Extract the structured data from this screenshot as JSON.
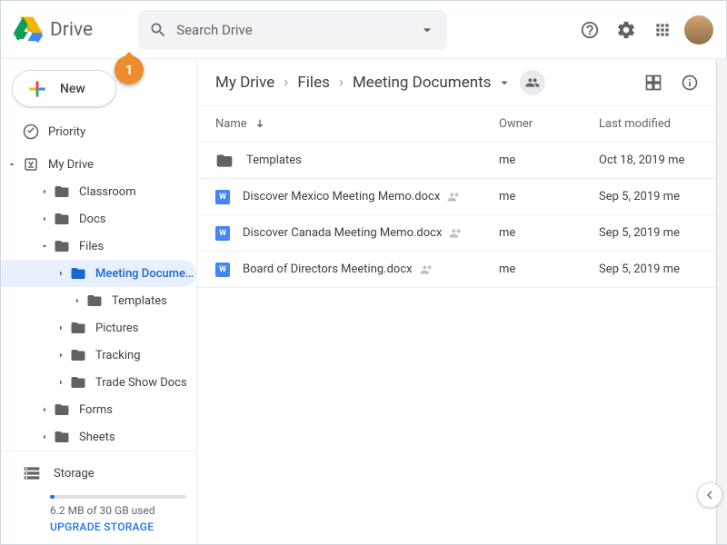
{
  "app": {
    "name": "Drive",
    "search_placeholder": "Search Drive",
    "new_label": "New"
  },
  "nav": {
    "priority": "Priority",
    "mydrive": "My Drive",
    "items": [
      {
        "label": "Classroom"
      },
      {
        "label": "Docs"
      },
      {
        "label": "Files",
        "expanded": true,
        "children": [
          {
            "label": "Meeting Documen...",
            "selected": true,
            "children": [
              {
                "label": "Templates"
              }
            ]
          },
          {
            "label": "Pictures"
          },
          {
            "label": "Tracking"
          },
          {
            "label": "Trade Show Docs"
          }
        ]
      },
      {
        "label": "Forms"
      },
      {
        "label": "Sheets"
      }
    ]
  },
  "storage": {
    "title": "Storage",
    "usage": "6.2 MB of 30 GB used",
    "upgrade": "UPGRADE STORAGE"
  },
  "breadcrumb": {
    "a": "My Drive",
    "b": "Files",
    "c": "Meeting Documents"
  },
  "columns": {
    "name": "Name",
    "owner": "Owner",
    "modified": "Last modified"
  },
  "files": [
    {
      "type": "folder",
      "name": "Templates",
      "owner": "me",
      "modified": "Oct 18, 2019 me",
      "shared": false
    },
    {
      "type": "docx",
      "name": "Discover Mexico Meeting Memo.docx",
      "owner": "me",
      "modified": "Sep 5, 2019 me",
      "shared": true
    },
    {
      "type": "docx",
      "name": "Discover Canada Meeting Memo.docx",
      "owner": "me",
      "modified": "Sep 5, 2019 me",
      "shared": true
    },
    {
      "type": "docx",
      "name": "Board of Directors Meeting.docx",
      "owner": "me",
      "modified": "Sep 5, 2019 me",
      "shared": true
    }
  ],
  "callout": {
    "num": "1"
  }
}
